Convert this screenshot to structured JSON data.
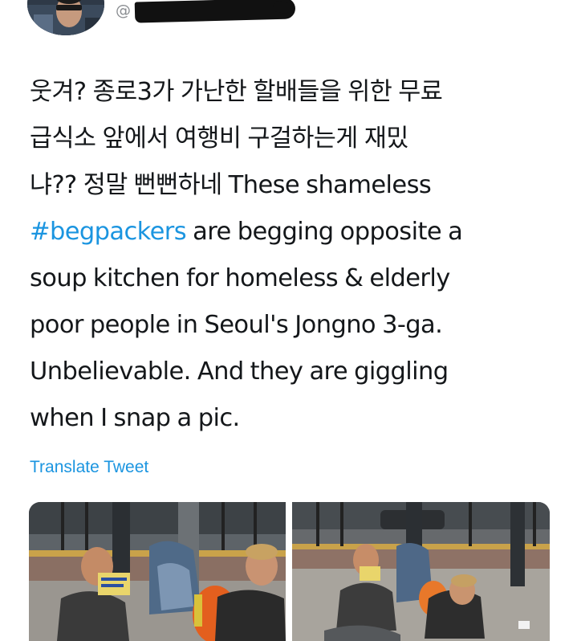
{
  "author": {
    "handle_prefix": "@"
  },
  "tweet": {
    "lines": [
      "웃겨? 종로3가 가난한 할배들을 위한 무료",
      "급식소 앞에서 여행비 구걸하는게 재밌",
      "냐?? 정말 뻔뻔하네 These shameless",
      "are begging opposite a",
      "soup kitchen for homeless & elderly",
      "poor people in Seoul's Jongno 3-ga.",
      "Unbelievable. And they are giggling",
      "when I snap a pic."
    ],
    "hashtag": "#begpackers"
  },
  "actions": {
    "translate_label": "Translate Tweet"
  },
  "media": [
    {
      "description": "photo-1"
    },
    {
      "description": "photo-2"
    }
  ],
  "colors": {
    "link": "#1b95e0",
    "text": "#14171a",
    "muted": "#8a8d91"
  }
}
